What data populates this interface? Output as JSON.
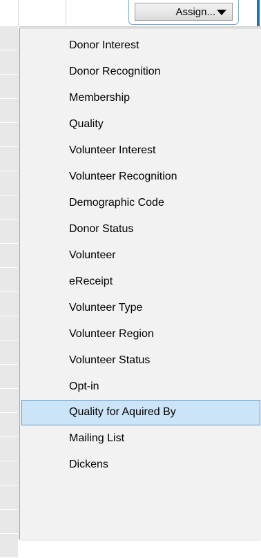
{
  "assign_button": {
    "label": "Assign..."
  },
  "menu": {
    "selected_index": 14,
    "items": [
      {
        "label": "Donor Interest"
      },
      {
        "label": "Donor Recognition"
      },
      {
        "label": "Membership"
      },
      {
        "label": "Quality"
      },
      {
        "label": "Volunteer Interest"
      },
      {
        "label": "Volunteer Recognition"
      },
      {
        "label": "Demographic Code"
      },
      {
        "label": "Donor Status"
      },
      {
        "label": "Volunteer"
      },
      {
        "label": "eReceipt"
      },
      {
        "label": "Volunteer Type"
      },
      {
        "label": "Volunteer Region"
      },
      {
        "label": "Volunteer Status"
      },
      {
        "label": "Opt-in"
      },
      {
        "label": "Quality for Aquired By"
      },
      {
        "label": "Mailing List"
      },
      {
        "label": "Dickens"
      }
    ]
  },
  "colors": {
    "highlight_fill": "#cce4f7",
    "highlight_border": "#5b9bd5",
    "menu_background": "#f2f2f2",
    "accent_bar": "#1f6fb4"
  }
}
